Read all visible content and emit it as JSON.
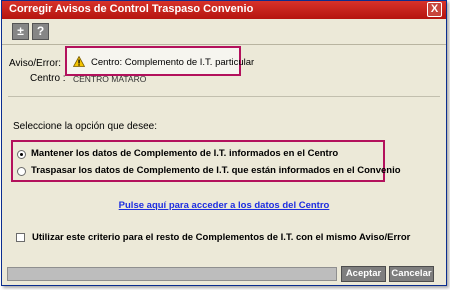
{
  "window": {
    "title": "Corregir Avisos de Control Traspaso Convenio",
    "close_glyph": "X"
  },
  "toolbar": {
    "plusminus_glyph": "±",
    "help_glyph": "?"
  },
  "fields": {
    "aviso_label": "Aviso/Error:",
    "aviso_value": "Centro: Complemento de I.T. particular",
    "centro_label": "Centro :",
    "centro_value": "CENTRO MATARO"
  },
  "options": {
    "prompt": "Seleccione la opción que desee:",
    "option1": "Mantener los datos de Complemento de I.T. informados en el Centro",
    "option2": "Traspasar los datos de Complemento de I.T. que están informados en el Convenio",
    "selected": 1
  },
  "link_text": "Pulse aquí para acceder a los datos del Centro",
  "checkbox_label": "Utilizar este criterio para el resto de Complementos de I.T. con el mismo Aviso/Error",
  "buttons": {
    "accept": "Aceptar",
    "cancel": "Cancelar"
  },
  "colors": {
    "titlebar": "#c41e17",
    "highlight_border": "#b3115c",
    "link": "#1c2de0",
    "button": "#7e7e7e"
  }
}
